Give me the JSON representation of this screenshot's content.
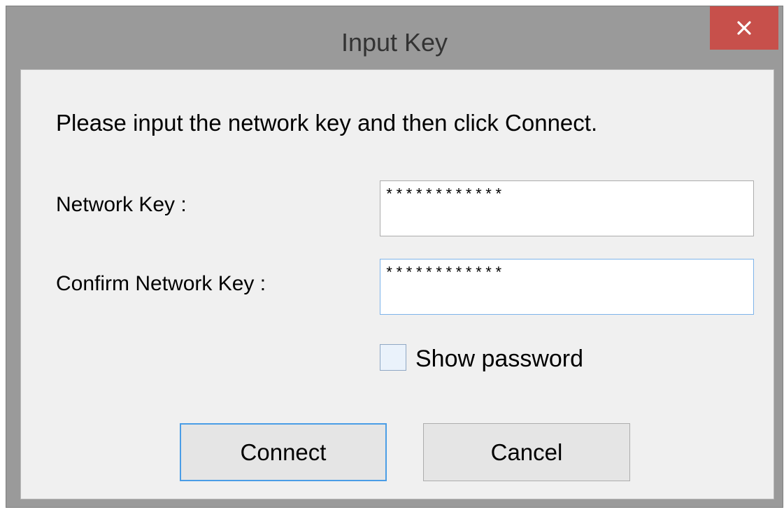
{
  "window": {
    "title": "Input Key",
    "close_icon": "close-icon",
    "close_color": "#c7504b"
  },
  "dialog": {
    "instruction": "Please input the network key and then click Connect.",
    "network_key_label": "Network Key :",
    "network_key_value": "************",
    "confirm_key_label": "Confirm Network Key :",
    "confirm_key_value": "************",
    "show_password_label": "Show password",
    "show_password_checked": false,
    "connect_label": "Connect",
    "cancel_label": "Cancel"
  }
}
